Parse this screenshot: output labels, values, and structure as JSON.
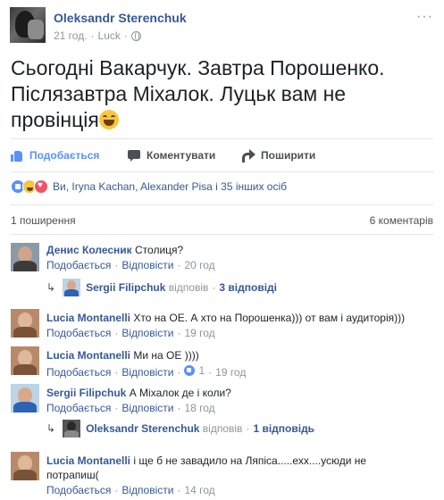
{
  "post": {
    "author": "Oleksandr Sterenchuk",
    "time": "21 год.",
    "location": "Luck",
    "more_icon": "ellipsis-icon",
    "privacy_icon": "globe-icon",
    "text": "Сьогодні Вакарчук. Завтра Порошенко. Післязавтра Міхалок. Луцьк вам не провінція",
    "text_emoji": "laughing-emoji"
  },
  "actions": {
    "like": "Подобається",
    "comment": "Коментувати",
    "share": "Поширити"
  },
  "reactions": {
    "icons": [
      "like",
      "haha",
      "love"
    ],
    "summary": "Ви, Iryna Kachan, Alexander Pisa і 35 інших осіб"
  },
  "stats": {
    "shares": "1 поширення",
    "comments": "6 коментарів"
  },
  "comments": [
    {
      "author": "Денис Колесник",
      "text": "Столиця?",
      "like": "Подобається",
      "reply": "Відповісти",
      "time": "20 год",
      "replies": {
        "author": "Sergii Filipchuk",
        "verb": "відповів",
        "count": "3 відповіді"
      }
    },
    {
      "author": "Lucia Montanelli",
      "text": "Хто на ОЕ. А хто на Порошенка))) от вам і аудиторія)))",
      "like": "Подобається",
      "reply": "Відповісти",
      "time": "19 год"
    },
    {
      "author": "Lucia Montanelli",
      "text": "Ми на ОЕ ))))",
      "like": "Подобається",
      "reply": "Відповісти",
      "likes": "1",
      "time": "19 год"
    },
    {
      "author": "Sergii Filipchuk",
      "text": "А Міхалок де і коли?",
      "like": "Подобається",
      "reply": "Відповісти",
      "time": "18 год",
      "replies": {
        "author": "Oleksandr Sterenchuk",
        "verb": "відповів",
        "count": "1 відповідь"
      }
    },
    {
      "author": "Lucia Montanelli",
      "text": "і ще б не завадило на Ляпіса.....ехх....усюди не потрапиш(",
      "like": "Подобається",
      "reply": "Відповісти",
      "time": "14 год"
    }
  ]
}
